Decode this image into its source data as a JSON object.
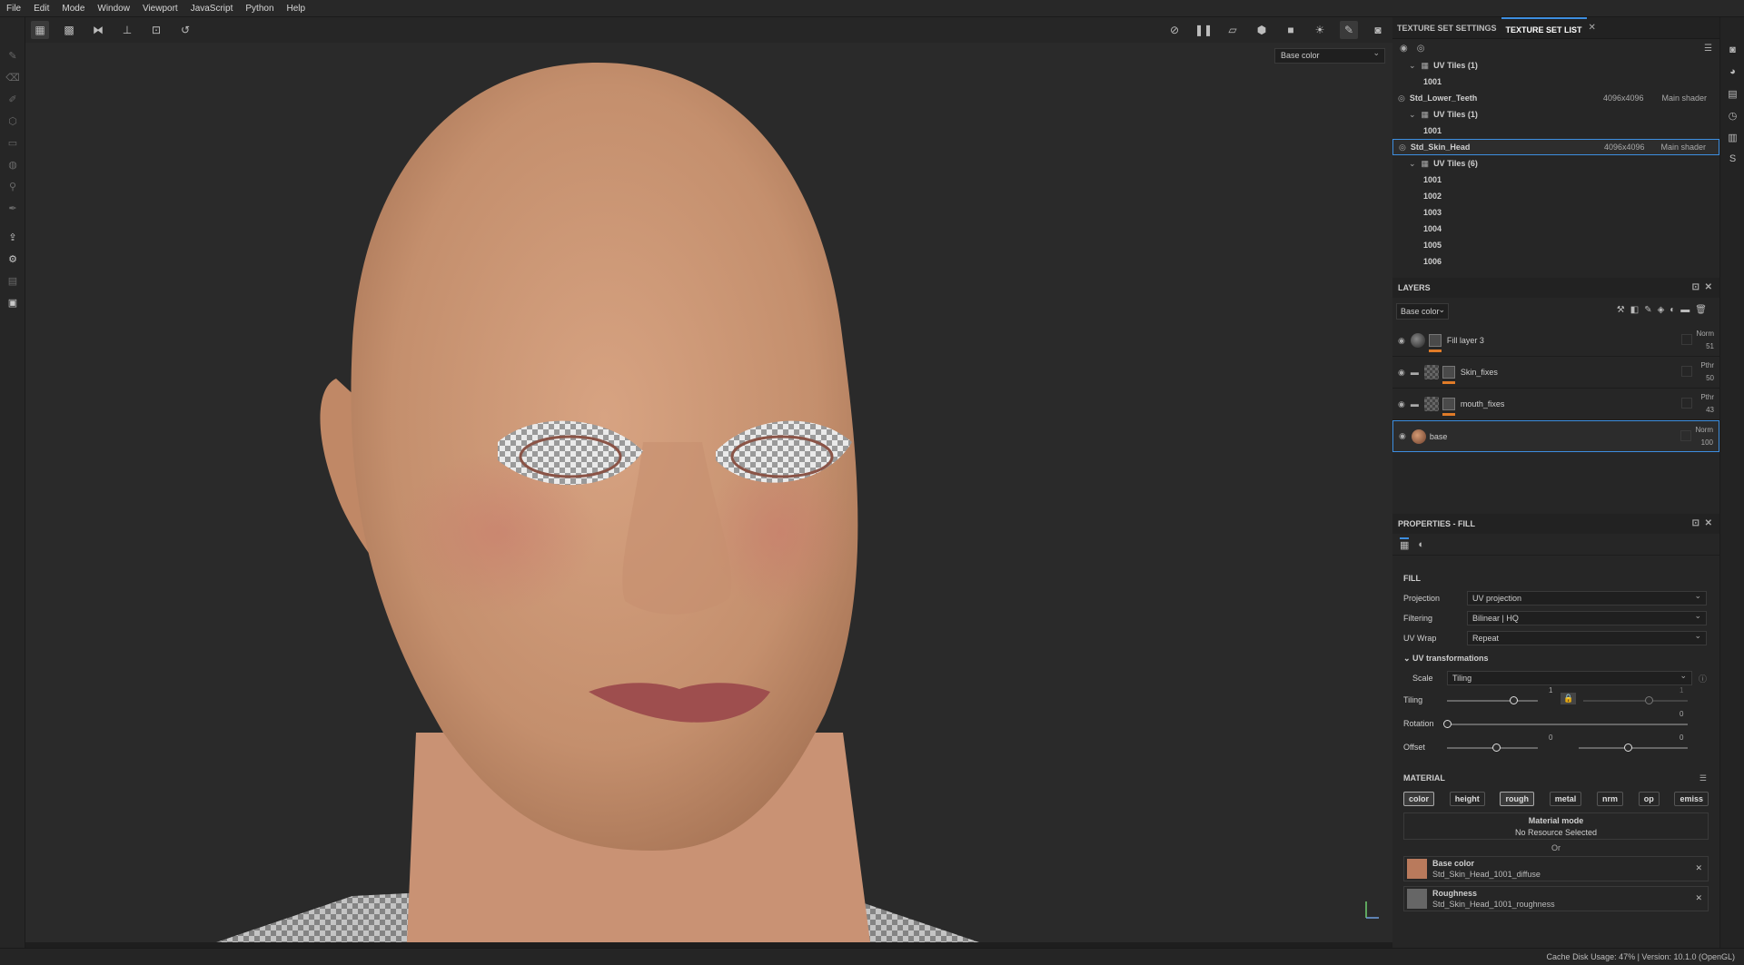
{
  "menu": [
    "File",
    "Edit",
    "Mode",
    "Window",
    "Viewport",
    "JavaScript",
    "Python",
    "Help"
  ],
  "viewport": {
    "channel_select": "Base color"
  },
  "texture_set": {
    "tabs": [
      "TEXTURE SET SETTINGS",
      "TEXTURE SET LIST"
    ],
    "rows": [
      {
        "kind": "uv",
        "label": "UV Tiles (1)"
      },
      {
        "kind": "tile",
        "label": "1001"
      },
      {
        "kind": "set",
        "label": "Std_Lower_Teeth",
        "size": "4096x4096",
        "shader": "Main shader"
      },
      {
        "kind": "uv",
        "label": "UV Tiles (1)"
      },
      {
        "kind": "tile",
        "label": "1001"
      },
      {
        "kind": "set",
        "label": "Std_Skin_Head",
        "size": "4096x4096",
        "shader": "Main shader",
        "selected": true
      },
      {
        "kind": "uv",
        "label": "UV Tiles (6)"
      },
      {
        "kind": "tile",
        "label": "1001"
      },
      {
        "kind": "tile",
        "label": "1002"
      },
      {
        "kind": "tile",
        "label": "1003"
      },
      {
        "kind": "tile",
        "label": "1004"
      },
      {
        "kind": "tile",
        "label": "1005"
      },
      {
        "kind": "tile",
        "label": "1006"
      }
    ]
  },
  "layers": {
    "title": "LAYERS",
    "channel": "Base color",
    "items": [
      {
        "name": "Fill layer 3",
        "blend": "Norm",
        "opacity": "51",
        "folder": false
      },
      {
        "name": "Skin_fixes",
        "blend": "Pthr",
        "opacity": "50",
        "folder": true
      },
      {
        "name": "mouth_fixes",
        "blend": "Pthr",
        "opacity": "43",
        "folder": true
      },
      {
        "name": "base",
        "blend": "Norm",
        "opacity": "100",
        "folder": false,
        "selected": true
      }
    ]
  },
  "properties": {
    "title": "PROPERTIES - FILL",
    "fill_label": "FILL",
    "projection": {
      "label": "Projection",
      "value": "UV projection"
    },
    "filtering": {
      "label": "Filtering",
      "value": "Bilinear | HQ"
    },
    "uvwrap": {
      "label": "UV Wrap",
      "value": "Repeat"
    },
    "uv_transform_label": "UV transformations",
    "scale": {
      "label": "Scale",
      "value": "Tiling"
    },
    "tiling": {
      "label": "Tiling",
      "value": "1",
      "value2": "1"
    },
    "rotation": {
      "label": "Rotation",
      "value": "0"
    },
    "offset": {
      "label": "Offset",
      "value": "0",
      "value2": "0"
    },
    "material_label": "MATERIAL",
    "channels": [
      "color",
      "height",
      "rough",
      "metal",
      "nrm",
      "op",
      "emiss"
    ],
    "material_mode": "Material mode",
    "no_resource": "No Resource Selected",
    "or": "Or",
    "resources": [
      {
        "channel": "Base color",
        "file": "Std_Skin_Head_1001_diffuse"
      },
      {
        "channel": "Roughness",
        "file": "Std_Skin_Head_1001_roughness"
      }
    ]
  },
  "status": "Cache Disk Usage:    47% | Version: 10.1.0 (OpenGL)",
  "colors": {
    "accent": "#3d8ee0",
    "orange": "#e07b28",
    "skin": "#d29c78"
  }
}
